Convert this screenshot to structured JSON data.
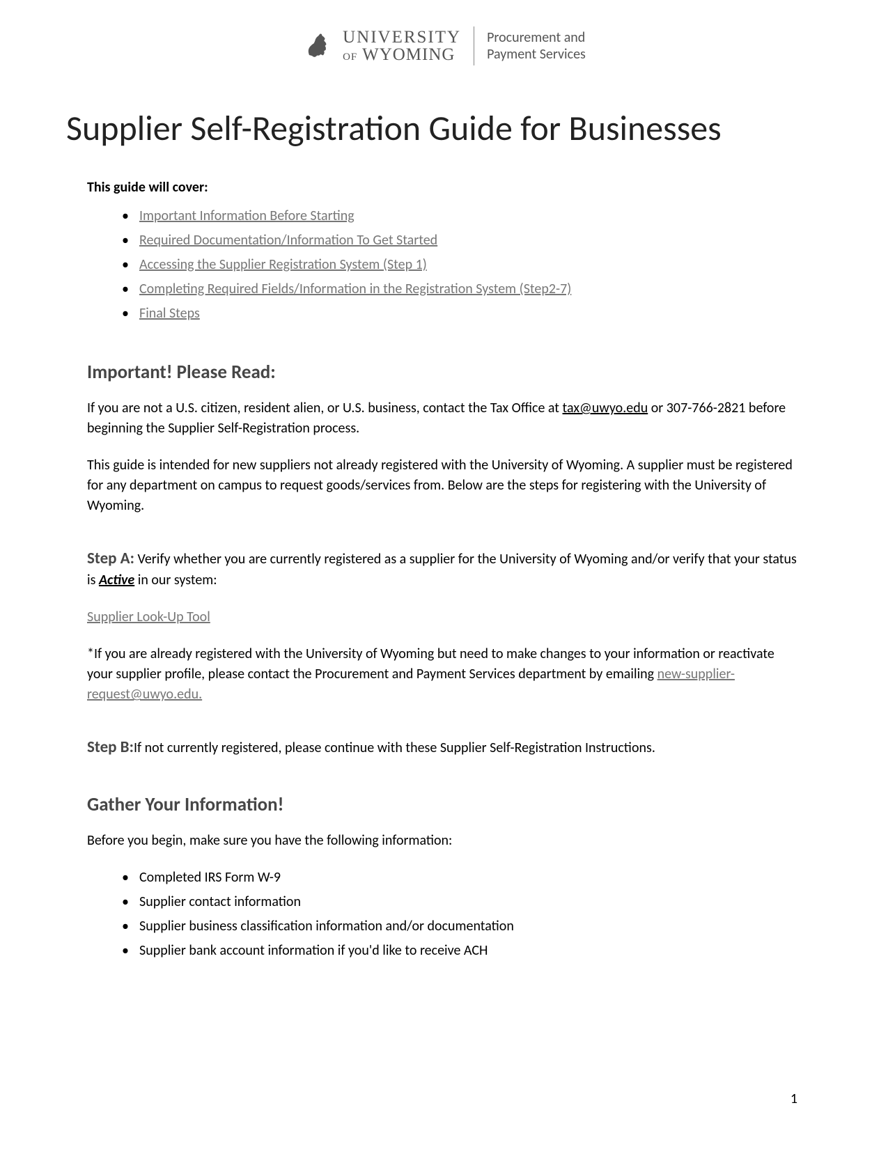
{
  "header": {
    "university_top": "UNIVERSITY",
    "university_of": "OF",
    "university_bottom": "WYOMING",
    "department_line1": "Procurement and",
    "department_line2": "Payment Services"
  },
  "title": "Supplier Self-Registration Guide for Businesses",
  "cover_label": "This guide will cover:",
  "toc": [
    "Important Information Before Starting",
    "Required Documentation/Information To Get Started",
    "Accessing the Supplier Registration System (Step 1)",
    "Completing Required Fields/Information in the Registration System (Step2-7)",
    "Final Steps"
  ],
  "important": {
    "heading": "Important! Please Read:",
    "p1_before": "If you are not a U.S. citizen, resident alien, or U.S. business, contact the Tax Office at ",
    "p1_link": "tax@uwyo.edu",
    "p1_after": " or 307-766-2821 before beginning the Supplier Self-Registration process.",
    "p2": "This guide is intended for new suppliers not already registered with the University of Wyoming. A supplier must be registered for any department on campus to request goods/services from. Below are the steps for registering with the University of Wyoming."
  },
  "stepA": {
    "label": "Step A:",
    "text_before": " Verify whether you are currently registered as a supplier for the University of Wyoming and/or verify that your status is ",
    "emph": "Active",
    "text_after": " in our system:",
    "tool_link": "Supplier Look-Up Tool",
    "note_before": "*If you are already registered with the University of Wyoming but need to make changes to your information or reactivate your supplier profile, please contact the Procurement and Payment Services department by emailing ",
    "note_link": "new-supplier-request@uwyo.edu."
  },
  "stepB": {
    "label": "Step B:",
    "text": "If not currently registered, please continue with these Supplier Self-Registration Instructions."
  },
  "gather": {
    "heading": "Gather Your Information!",
    "intro": "Before you begin, make sure you have the following information:",
    "items": [
      "Completed IRS Form W-9",
      "Supplier contact information",
      "Supplier business classification information and/or documentation",
      "Supplier bank account information if you'd like to receive ACH"
    ]
  },
  "page_number": "1"
}
